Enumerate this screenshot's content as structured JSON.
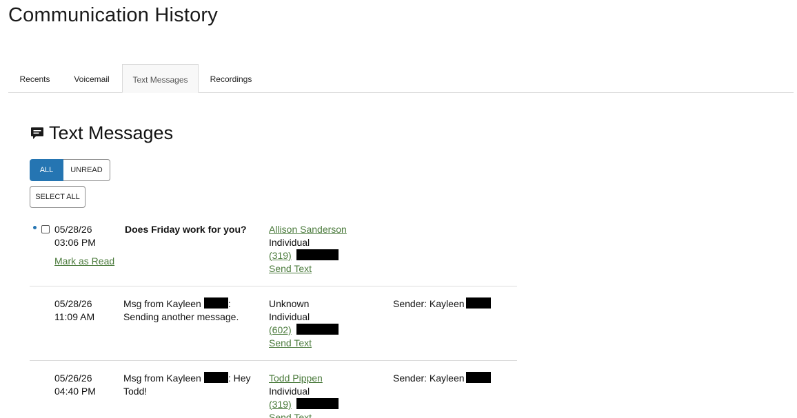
{
  "page": {
    "title": "Communication History"
  },
  "tabs": [
    {
      "label": "Recents",
      "active": false
    },
    {
      "label": "Voicemail",
      "active": false
    },
    {
      "label": "Text Messages",
      "active": true
    },
    {
      "label": "Recordings",
      "active": false
    }
  ],
  "section": {
    "title": "Text Messages",
    "icon": "chat-bubble-icon"
  },
  "filters": {
    "all_label": "ALL",
    "unread_label": "UNREAD",
    "selected": "ALL"
  },
  "select_all_label": "SELECT ALL",
  "colors": {
    "accent": "#2575b2",
    "link": "#4a7a3b",
    "divider": "#dcdcdc"
  },
  "messages": [
    {
      "unread": true,
      "date": "05/28/26",
      "time": "03:06 PM",
      "mark_read_label": "Mark as Read",
      "message_line1": "Does Friday work for you?",
      "contact_name": "Allison Sanderson",
      "contact_type": "Individual",
      "phone_area": "(319)",
      "send_text_label": "Send Text",
      "sender_label": ""
    },
    {
      "unread": false,
      "date": "05/28/26",
      "time": "11:09 AM",
      "message_line1_pre": "Msg from Kayleen",
      "message_line1_post": ":",
      "message_line2": "Sending another message.",
      "contact_name": "Unknown",
      "contact_type": "Individual",
      "phone_area": "(602)",
      "send_text_label": "Send Text",
      "sender_label": "Sender: Kayleen"
    },
    {
      "unread": false,
      "date": "05/26/26",
      "time": "04:40 PM",
      "message_line1_pre": "Msg from Kayleen",
      "message_line1_post": ": Hey",
      "message_line2": "Todd!",
      "contact_name": "Todd Pippen",
      "contact_type": "Individual",
      "phone_area": "(319)",
      "send_text_label": "Send Text",
      "sender_label": "Sender: Kayleen"
    }
  ]
}
